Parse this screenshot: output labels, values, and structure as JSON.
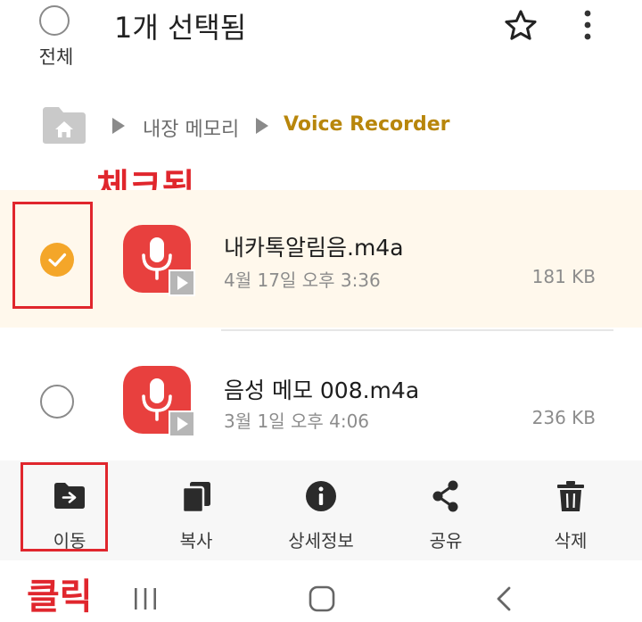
{
  "header": {
    "select_all_label": "전체",
    "title": "1개 선택됨"
  },
  "breadcrumb": {
    "items": [
      "내장 메모리",
      "Voice Recorder"
    ]
  },
  "annotations": {
    "checked_label": "체크됨",
    "click_label": "클릭"
  },
  "files": [
    {
      "name": "내카톡알림음.m4a",
      "date": "4월 17일 오후 3:36",
      "size": "181 KB",
      "selected": true
    },
    {
      "name": "음성 메모 008.m4a",
      "date": "3월 1일 오후 4:06",
      "size": "236 KB",
      "selected": false
    }
  ],
  "actions": [
    {
      "label": "이동",
      "icon": "move-folder-icon"
    },
    {
      "label": "복사",
      "icon": "copy-icon"
    },
    {
      "label": "상세정보",
      "icon": "info-icon"
    },
    {
      "label": "공유",
      "icon": "share-icon"
    },
    {
      "label": "삭제",
      "icon": "trash-icon"
    }
  ],
  "colors": {
    "accent": "#b8860b",
    "selected_row": "#fff8ec",
    "checkbox_checked": "#f4a629",
    "file_icon": "#e8403e",
    "annotation": "#e0262d"
  }
}
